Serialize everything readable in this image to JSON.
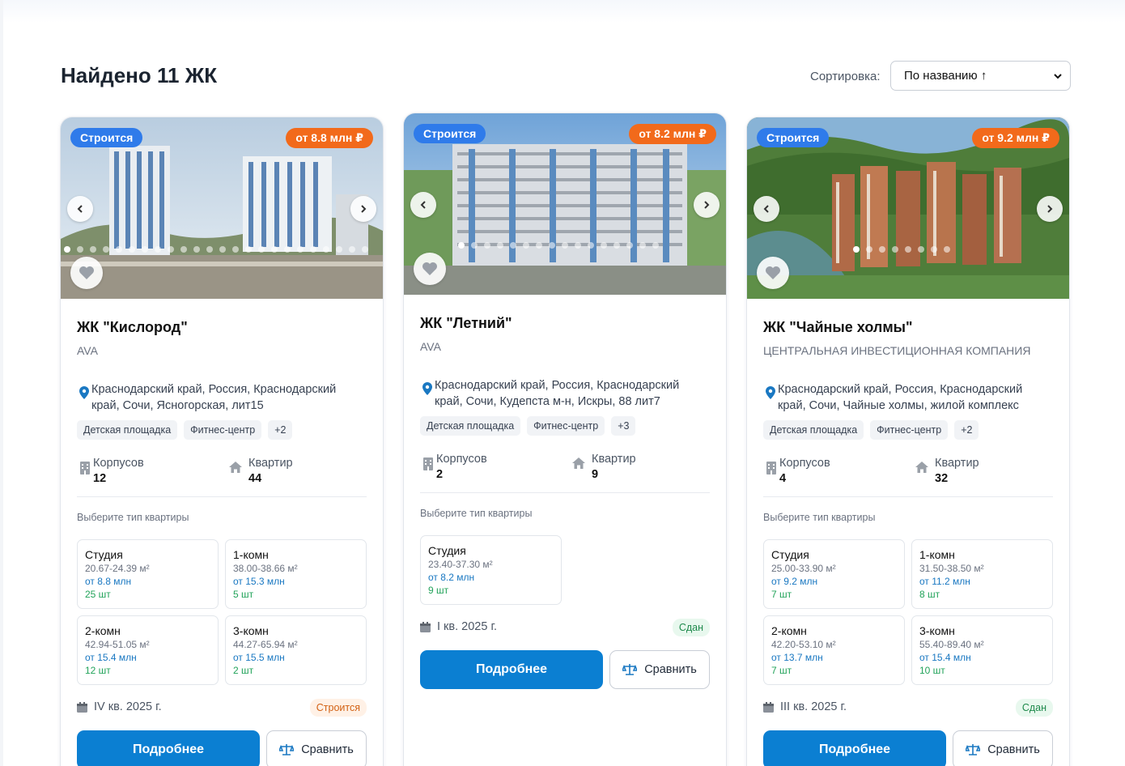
{
  "header": {
    "title": "Найдено 11 ЖК",
    "sort_label": "Сортировка:",
    "sort_value": "По названию ↑"
  },
  "colors": {
    "accent": "#0b7fd2",
    "status_badge": "#2f7bea",
    "price_badge": "#f26a1b",
    "in_progress": "#d26114",
    "completed": "#1f8a4c"
  },
  "cards": [
    {
      "status_badge": "Строится",
      "price_badge": "от 8.8 млн ₽",
      "name": "ЖК \"Кислород\"",
      "developer": "AVA",
      "address": "Краснодарский край, Россия, Краснодарский край, Сочи, Ясногорская, лит15",
      "tags": [
        "Детская площадка",
        "Фитнес-центр",
        "+2"
      ],
      "buildings_label": "Корпусов",
      "buildings": "12",
      "apartments_label": "Квартир",
      "apartments": "44",
      "choose_label": "Выберите тип квартиры",
      "units": [
        {
          "type": "Студия",
          "area": "20.67-24.39 м²",
          "price": "от 8.8 млн",
          "qty": "25 шт"
        },
        {
          "type": "1-комн",
          "area": "38.00-38.66 м²",
          "price": "от 15.3 млн",
          "qty": "5 шт"
        },
        {
          "type": "2-комн",
          "area": "42.94-51.05 м²",
          "price": "от 15.4 млн",
          "qty": "12 шт"
        },
        {
          "type": "3-комн",
          "area": "44.27-65.94 м²",
          "price": "от 15.5 млн",
          "qty": "2 шт"
        }
      ],
      "deadline": "IV кв. 2025 г.",
      "state": "Строится",
      "more": "Подробнее",
      "compare": "Сравнить"
    },
    {
      "status_badge": "Строится",
      "price_badge": "от 8.2 млн ₽",
      "name": "ЖК \"Летний\"",
      "developer": "AVA",
      "address": "Краснодарский край, Россия, Краснодарский край, Сочи, Кудепста м-н, Искры, 88 лит7",
      "tags": [
        "Детская площадка",
        "Фитнес-центр",
        "+3"
      ],
      "buildings_label": "Корпусов",
      "buildings": "2",
      "apartments_label": "Квартир",
      "apartments": "9",
      "choose_label": "Выберите тип квартиры",
      "units": [
        {
          "type": "Студия",
          "area": "23.40-37.30 м²",
          "price": "от 8.2 млн",
          "qty": "9 шт"
        }
      ],
      "deadline": "I кв. 2025 г.",
      "state": "Сдан",
      "more": "Подробнее",
      "compare": "Сравнить"
    },
    {
      "status_badge": "Строится",
      "price_badge": "от 9.2 млн ₽",
      "name": "ЖК \"Чайные холмы\"",
      "developer": "ЦЕНТРАЛЬНАЯ ИНВЕСТИЦИОННАЯ КОМПАНИЯ",
      "address": "Краснодарский край, Россия, Краснодарский край, Сочи, Чайные холмы, жилой комплекс",
      "tags": [
        "Детская площадка",
        "Фитнес-центр",
        "+2"
      ],
      "buildings_label": "Корпусов",
      "buildings": "4",
      "apartments_label": "Квартир",
      "apartments": "32",
      "choose_label": "Выберите тип квартиры",
      "units": [
        {
          "type": "Студия",
          "area": "25.00-33.90 м²",
          "price": "от 9.2 млн",
          "qty": "7 шт"
        },
        {
          "type": "1-комн",
          "area": "31.50-38.50 м²",
          "price": "от 11.2 млн",
          "qty": "8 шт"
        },
        {
          "type": "2-комн",
          "area": "42.20-53.10 м²",
          "price": "от 13.7 млн",
          "qty": "7 шт"
        },
        {
          "type": "3-комн",
          "area": "55.40-89.40 м²",
          "price": "от 15.4 млн",
          "qty": "10 шт"
        }
      ],
      "deadline": "III кв. 2025 г.",
      "state": "Сдан",
      "more": "Подробнее",
      "compare": "Сравнить"
    }
  ]
}
